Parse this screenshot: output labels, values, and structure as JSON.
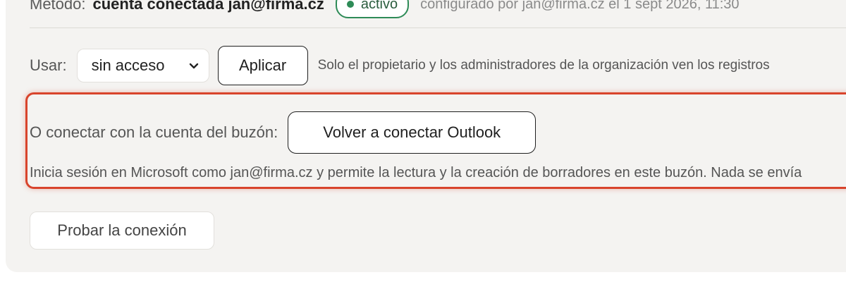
{
  "method": {
    "label": "Método:",
    "value": "cuenta conectada jan@firma.cz",
    "status_badge": "activo",
    "configured_text": "configurado por jan@firma.cz el 1 sept 2026, 11:30",
    "status_color": "#2e8b57"
  },
  "usage": {
    "label": "Usar:",
    "selected_option": "sin acceso",
    "apply_label": "Aplicar",
    "owner_note": "Solo el propietario y los administradores de la organización ven los registros"
  },
  "connect": {
    "label": "O conectar con la cuenta del buzón:",
    "reconnect_label": "Volver a conectar Outlook",
    "signin_note": "Inicia sesión en Microsoft como jan@firma.cz y permite la lectura y la creación de borradores en este buzón. Nada se envía",
    "highlight_color": "#d8442c"
  },
  "actions": {
    "test_label": "Probar la conexión"
  },
  "icons": {
    "select_arrow": "chevron-down-icon",
    "status_dot": "status-dot-icon"
  }
}
